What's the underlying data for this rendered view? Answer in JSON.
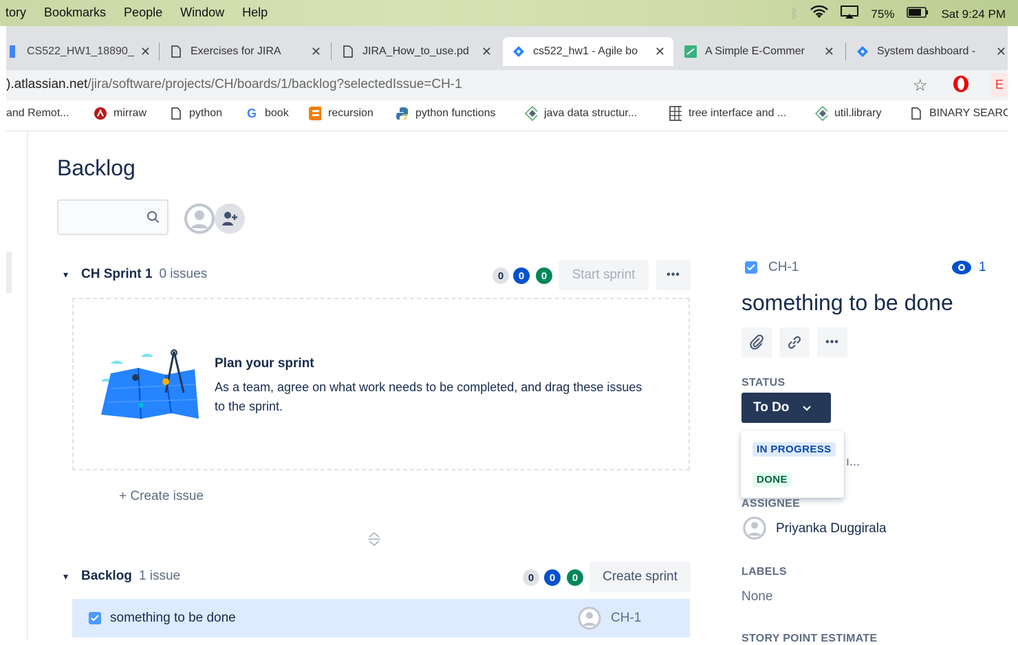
{
  "menubar": {
    "items": [
      "tory",
      "Bookmarks",
      "People",
      "Window",
      "Help"
    ],
    "battery": "75%",
    "clock": "Sat 9:24 PM"
  },
  "tabs": [
    {
      "title": "CS522_HW1_18890_",
      "icon": "doc-blue-icon"
    },
    {
      "title": "Exercises for JIRA",
      "icon": "page-icon"
    },
    {
      "title": "JIRA_How_to_use.pd",
      "icon": "page-icon"
    },
    {
      "title": "cs522_hw1 - Agile bo",
      "icon": "jira-icon"
    },
    {
      "title": "A Simple E-Commer",
      "icon": "green-square-icon"
    },
    {
      "title": "System dashboard -",
      "icon": "jira-icon"
    }
  ],
  "address": {
    "host": ").atlassian.net",
    "path": "/jira/software/projects/CH/boards/1/backlog?selectedIssue=CH-1"
  },
  "bookmarks": [
    {
      "label": "and Remot...",
      "icon": "none"
    },
    {
      "label": "mirraw",
      "icon": "mirraw-icon"
    },
    {
      "label": "python",
      "icon": "page-icon"
    },
    {
      "label": "book",
      "icon": "google-icon"
    },
    {
      "label": "recursion",
      "icon": "blogger-icon"
    },
    {
      "label": "python functions",
      "icon": "python-icon"
    },
    {
      "label": "java data structur...",
      "icon": "diamond-icon"
    },
    {
      "label": "tree interface and ...",
      "icon": "grid-icon"
    },
    {
      "label": "util.library",
      "icon": "diamond-icon"
    },
    {
      "label": "BINARY SEARC",
      "icon": "page-icon"
    }
  ],
  "backlog": {
    "title": "Backlog",
    "sprint": {
      "name": "CH Sprint 1",
      "count": "0 issues",
      "pills": [
        "0",
        "0",
        "0"
      ],
      "start_label": "Start sprint",
      "more": "•••",
      "plan_title": "Plan your sprint",
      "plan_desc": "As a team, agree on what work needs to be completed, and drag these issues to the sprint.",
      "create_issue": "+ Create issue"
    },
    "backlog_section": {
      "name": "Backlog",
      "count": "1 issue",
      "pills": [
        "0",
        "0",
        "0"
      ],
      "create_sprint_label": "Create sprint",
      "issues": [
        {
          "summary": "something to be done",
          "key": "CH-1"
        }
      ]
    }
  },
  "detail": {
    "key": "CH-1",
    "watchers": "1",
    "title": "something to be done",
    "more": "•••",
    "status_label": "STATUS",
    "status_value": "To Do",
    "status_options": [
      "IN PROGRESS",
      "DONE"
    ],
    "hidden_text": "ı...",
    "assignee_label": "ASSIGNEE",
    "assignee": "Priyanka Duggirala",
    "labels_label": "LABELS",
    "labels_value": "None",
    "story_label": "STORY POINT ESTIMATE"
  },
  "colors": {
    "jira_blue": "#0052cc",
    "success_green": "#00875a",
    "status_button": "#253858",
    "selected_row": "#deebff"
  }
}
